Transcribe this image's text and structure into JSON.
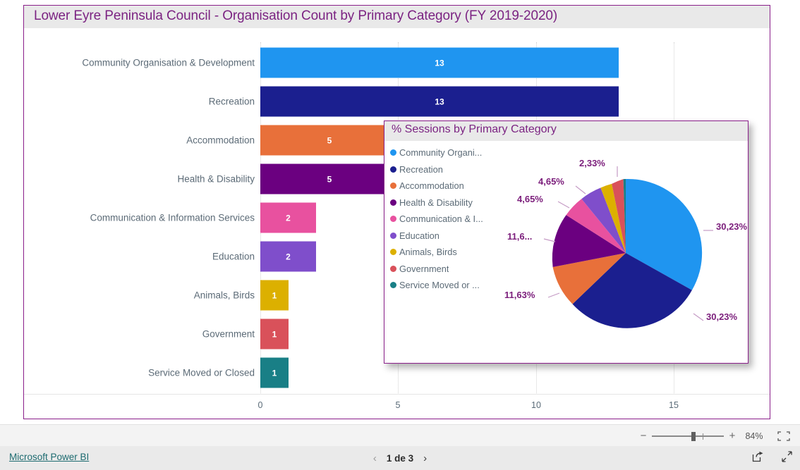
{
  "report": {
    "bar_visual_title": "Lower Eyre Peninsula Council - Organisation Count by Primary Category (FY 2019-2020)",
    "pie_visual_title": "% Sessions by Primary Category"
  },
  "colors": {
    "community": "#1f95f0",
    "recreation": "#1b1f8f",
    "accommodation": "#e8703a",
    "health": "#6b0080",
    "communication": "#e8519f",
    "education": "#7f4ecb",
    "animals": "#dcb000",
    "government": "#d9515a",
    "service_moved": "#197f86",
    "accent_purple": "#8a1f8a",
    "title_text": "#7b2382",
    "label_text": "#5c6b77",
    "pie_label": "#7b1d7b",
    "link_teal": "#1d6b70"
  },
  "chart_data": [
    {
      "type": "bar",
      "title": "Lower Eyre Peninsula Council - Organisation Count by Primary Category (FY 2019-2020)",
      "orientation": "horizontal",
      "xlabel": "",
      "ylabel": "",
      "xlim": [
        0,
        16.5
      ],
      "grid": true,
      "xticks": [
        "0",
        "5",
        "10",
        "15"
      ],
      "xtick_values": [
        0,
        5,
        10,
        15
      ],
      "categories": [
        "Community Organisation & Development",
        "Recreation",
        "Accommodation",
        "Health & Disability",
        "Communication & Information Services",
        "Education",
        "Animals, Birds",
        "Government",
        "Service Moved or Closed"
      ],
      "values": [
        13,
        13,
        5,
        5,
        2,
        2,
        1,
        1,
        1
      ],
      "value_labels": [
        "13",
        "13",
        "5",
        "5",
        "2",
        "2",
        "1",
        "1",
        "1"
      ],
      "bar_colors": [
        "#1f95f0",
        "#1b1f8f",
        "#e8703a",
        "#6b0080",
        "#e8519f",
        "#7f4ecb",
        "#dcb000",
        "#d9515a",
        "#197f86"
      ]
    },
    {
      "type": "pie",
      "title": "% Sessions by Primary Category",
      "legend_position": "left",
      "labels": [
        "Community Organi...",
        "Recreation",
        "Accommodation",
        "Health & Disability",
        "Communication & I...",
        "Education",
        "Animals, Birds",
        "Government",
        "Service Moved or ..."
      ],
      "values": [
        30.23,
        30.23,
        11.63,
        11.63,
        4.65,
        4.65,
        2.33,
        2.33,
        2.33
      ],
      "value_labels": [
        "30,23%",
        "30,23%",
        "11,63%",
        "11,6...",
        "4,65%",
        "4,65%",
        "2,33%",
        "",
        ""
      ],
      "slice_colors": [
        "#1f95f0",
        "#1b1f8f",
        "#e8703a",
        "#6b0080",
        "#e8519f",
        "#7f4ecb",
        "#dcb000",
        "#d9515a",
        "#197f86"
      ]
    }
  ],
  "toolbar": {
    "zoom_minus": "−",
    "zoom_plus": "+",
    "zoom_percent": "84%"
  },
  "footer": {
    "brand_link": "Microsoft Power BI",
    "prev_arrow": "‹",
    "page_text": "1 de 3",
    "next_arrow": "›"
  }
}
